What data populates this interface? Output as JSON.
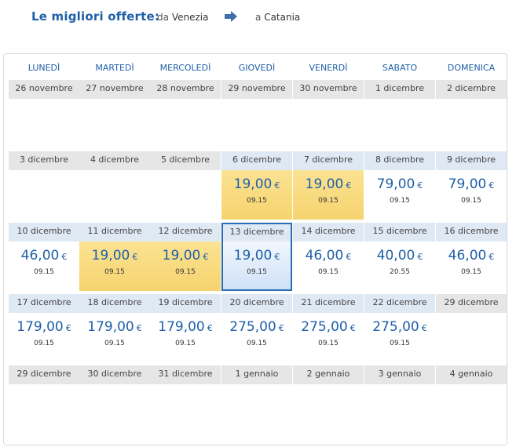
{
  "header": {
    "title": "Le migliori offerte:",
    "from_prefix": "da",
    "from_city": "Venezia",
    "to_prefix": "a",
    "to_city": "Catania"
  },
  "weekdays": [
    "LUNEDÌ",
    "MARTEDÌ",
    "MERCOLEDÌ",
    "GIOVEDÌ",
    "VENERDÌ",
    "SABATO",
    "DOMENICA"
  ],
  "weeks": [
    [
      {
        "date": "26 novembre"
      },
      {
        "date": "27 novembre"
      },
      {
        "date": "28 novembre"
      },
      {
        "date": "29 novembre"
      },
      {
        "date": "30 novembre"
      },
      {
        "date": "1 dicembre"
      },
      {
        "date": "2 dicembre"
      }
    ],
    [
      {
        "date": "3 dicembre"
      },
      {
        "date": "4 dicembre"
      },
      {
        "date": "5 dicembre"
      },
      {
        "date": "6 dicembre",
        "price": "19,00",
        "currency": "€",
        "time": "09.15",
        "deal": true
      },
      {
        "date": "7 dicembre",
        "price": "19,00",
        "currency": "€",
        "time": "09.15",
        "deal": true
      },
      {
        "date": "8 dicembre",
        "price": "79,00",
        "currency": "€",
        "time": "09.15"
      },
      {
        "date": "9 dicembre",
        "price": "79,00",
        "currency": "€",
        "time": "09.15"
      }
    ],
    [
      {
        "date": "10 dicembre",
        "price": "46,00",
        "currency": "€",
        "time": "09.15"
      },
      {
        "date": "11 dicembre",
        "price": "19,00",
        "currency": "€",
        "time": "09.15",
        "deal": true
      },
      {
        "date": "12 dicembre",
        "price": "19,00",
        "currency": "€",
        "time": "09.15",
        "deal": true
      },
      {
        "date": "13 dicembre",
        "price": "19,00",
        "currency": "€",
        "time": "09.15",
        "selected": true
      },
      {
        "date": "14 dicembre",
        "price": "46,00",
        "currency": "€",
        "time": "09.15"
      },
      {
        "date": "15 dicembre",
        "price": "40,00",
        "currency": "€",
        "time": "20.55"
      },
      {
        "date": "16 dicembre",
        "price": "46,00",
        "currency": "€",
        "time": "09.15"
      }
    ],
    [
      {
        "date": "17 dicembre",
        "price": "179,00",
        "currency": "€",
        "time": "09.15"
      },
      {
        "date": "18 dicembre",
        "price": "179,00",
        "currency": "€",
        "time": "09.15"
      },
      {
        "date": "19 dicembre",
        "price": "179,00",
        "currency": "€",
        "time": "09.15"
      },
      {
        "date": "20 dicembre",
        "price": "275,00",
        "currency": "€",
        "time": "09.15"
      },
      {
        "date": "21 dicembre",
        "price": "275,00",
        "currency": "€",
        "time": "09.15"
      },
      {
        "date": "22 dicembre",
        "price": "275,00",
        "currency": "€",
        "time": "09.15"
      },
      {
        "date": "29 dicembre"
      }
    ],
    [
      {
        "date": "29 dicembre"
      },
      {
        "date": "30 dicembre"
      },
      {
        "date": "31 dicembre"
      },
      {
        "date": "1 gennaio"
      },
      {
        "date": "2 gennaio"
      },
      {
        "date": "3 gennaio"
      },
      {
        "date": "4 gennaio"
      }
    ]
  ],
  "colors": {
    "accent": "#1f5fa8",
    "deal_yellow": "#f9dc82",
    "date_gray": "#e6e6e6",
    "date_blue": "#dfe9f4"
  },
  "icons": {
    "route_arrow": "arrow-right-icon"
  }
}
